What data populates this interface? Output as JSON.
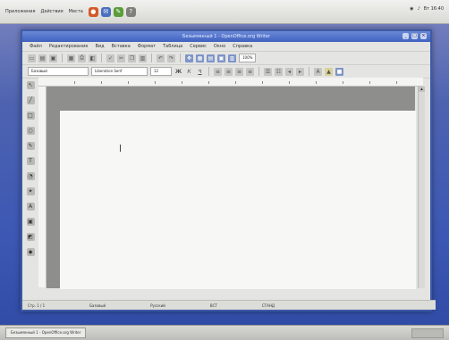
{
  "desktop": {
    "top_menu": [
      "Приложения",
      "Действия",
      "Места"
    ],
    "tray_text": "Вт 16:40"
  },
  "window": {
    "title": "Безымянный 1 - OpenOffice.org Writer",
    "menu": [
      "Файл",
      "Редактирование",
      "Вид",
      "Вставка",
      "Формат",
      "Таблица",
      "Сервис",
      "Окно",
      "Справка"
    ],
    "zoom": "100%",
    "style_combo": "Базовый",
    "font_combo": "Liberation Serif",
    "size_combo": "12",
    "status": {
      "page": "Стр. 1 / 1",
      "style": "Базовый",
      "lang": "Русский",
      "mode": "ВСТ",
      "std": "СТАНД"
    }
  },
  "taskbar": {
    "active_task": "Безымянный 1 - OpenOffice.org Writer"
  },
  "colors": {
    "desktop": "#4e63b0",
    "titlebar": "#3f62c2",
    "page": "#f7f7f5"
  }
}
